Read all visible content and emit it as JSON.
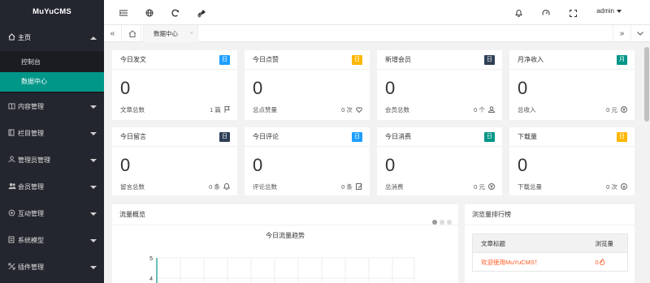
{
  "app": {
    "logo": "MuYuCMS"
  },
  "sidebar": {
    "home": {
      "label": "主页",
      "icon": "home-icon"
    },
    "sub_items": [
      {
        "label": "控制台"
      },
      {
        "label": "数据中心"
      }
    ],
    "items": [
      {
        "label": "内容管理",
        "icon": "content-icon"
      },
      {
        "label": "栏目管理",
        "icon": "column-icon"
      },
      {
        "label": "管理员管理",
        "icon": "admin-icon"
      },
      {
        "label": "会员管理",
        "icon": "users-icon"
      },
      {
        "label": "互动管理",
        "icon": "interact-icon"
      },
      {
        "label": "系统模型",
        "icon": "model-icon"
      },
      {
        "label": "插件管理",
        "icon": "plugin-icon"
      }
    ]
  },
  "header": {
    "user": "admin"
  },
  "tabs": {
    "active": "数据中心",
    "close": "×"
  },
  "cards": [
    {
      "title": "今日发文",
      "badge": "日",
      "badge_color": "#1e9fff",
      "value": "0",
      "label": "文章总数",
      "total": "1 篇",
      "icon": "flag-icon"
    },
    {
      "title": "今日点赞",
      "badge": "日",
      "badge_color": "#ffb800",
      "value": "0",
      "label": "总点赞量",
      "total": "0 次",
      "icon": "heart-icon"
    },
    {
      "title": "新增会员",
      "badge": "日",
      "badge_color": "#2f4056",
      "value": "0",
      "label": "会员总数",
      "total": "0 个",
      "icon": "user-icon"
    },
    {
      "title": "月净收入",
      "badge": "月",
      "badge_color": "#009688",
      "value": "0",
      "label": "总收入",
      "total": "0 元",
      "icon": "yen-icon"
    },
    {
      "title": "今日留言",
      "badge": "日",
      "badge_color": "#2f4056",
      "value": "0",
      "label": "留言总数",
      "total": "0 条",
      "icon": "bell-icon"
    },
    {
      "title": "今日评论",
      "badge": "日",
      "badge_color": "#1e9fff",
      "value": "0",
      "label": "评论总数",
      "total": "0 条",
      "icon": "edit-icon"
    },
    {
      "title": "今日消费",
      "badge": "日",
      "badge_color": "#009688",
      "value": "0",
      "label": "总消费",
      "total": "0 元",
      "icon": "yen-icon"
    },
    {
      "title": "下载量",
      "badge": "日",
      "badge_color": "#ffb800",
      "value": "0",
      "label": "下载总量",
      "total": "0 次",
      "icon": "download-icon"
    }
  ],
  "traffic": {
    "title": "流量概览",
    "chart_data": {
      "type": "line",
      "title": "今日流量趋势",
      "y_ticks": [
        "5",
        "4"
      ],
      "series": []
    }
  },
  "ranking": {
    "title": "浏览量排行榜",
    "columns": [
      "文章标题",
      "浏览量"
    ],
    "rows": [
      {
        "title": "欢迎使用MuYuCMS！",
        "views": "0"
      }
    ]
  }
}
